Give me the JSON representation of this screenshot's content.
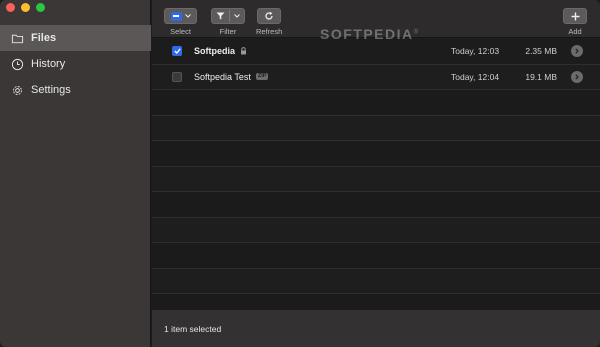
{
  "sidebar": {
    "items": [
      {
        "label": "Files",
        "icon": "folder-icon",
        "active": true
      },
      {
        "label": "History",
        "icon": "clock-icon",
        "active": false
      },
      {
        "label": "Settings",
        "icon": "gear-icon",
        "active": false
      }
    ]
  },
  "toolbar": {
    "select_label": "Select",
    "filter_label": "Filter",
    "refresh_label": "Refresh",
    "add_label": "Add"
  },
  "watermark": "SOFTPEDIA",
  "watermark_mark": "®",
  "files": [
    {
      "name": "Softpedia",
      "checked": true,
      "bold": true,
      "tag_icon": "lock-icon",
      "date": "Today, 12:03",
      "size": "2.35 MB"
    },
    {
      "name": "Softpedia Test",
      "checked": false,
      "bold": false,
      "tag": "ZIP",
      "date": "Today, 12:04",
      "size": "19.1 MB"
    }
  ],
  "status": {
    "text": "1 item selected"
  },
  "colors": {
    "accent": "#2f6be6",
    "sidebar_bg": "#3b3736",
    "list_bg": "#1e1e1e"
  }
}
